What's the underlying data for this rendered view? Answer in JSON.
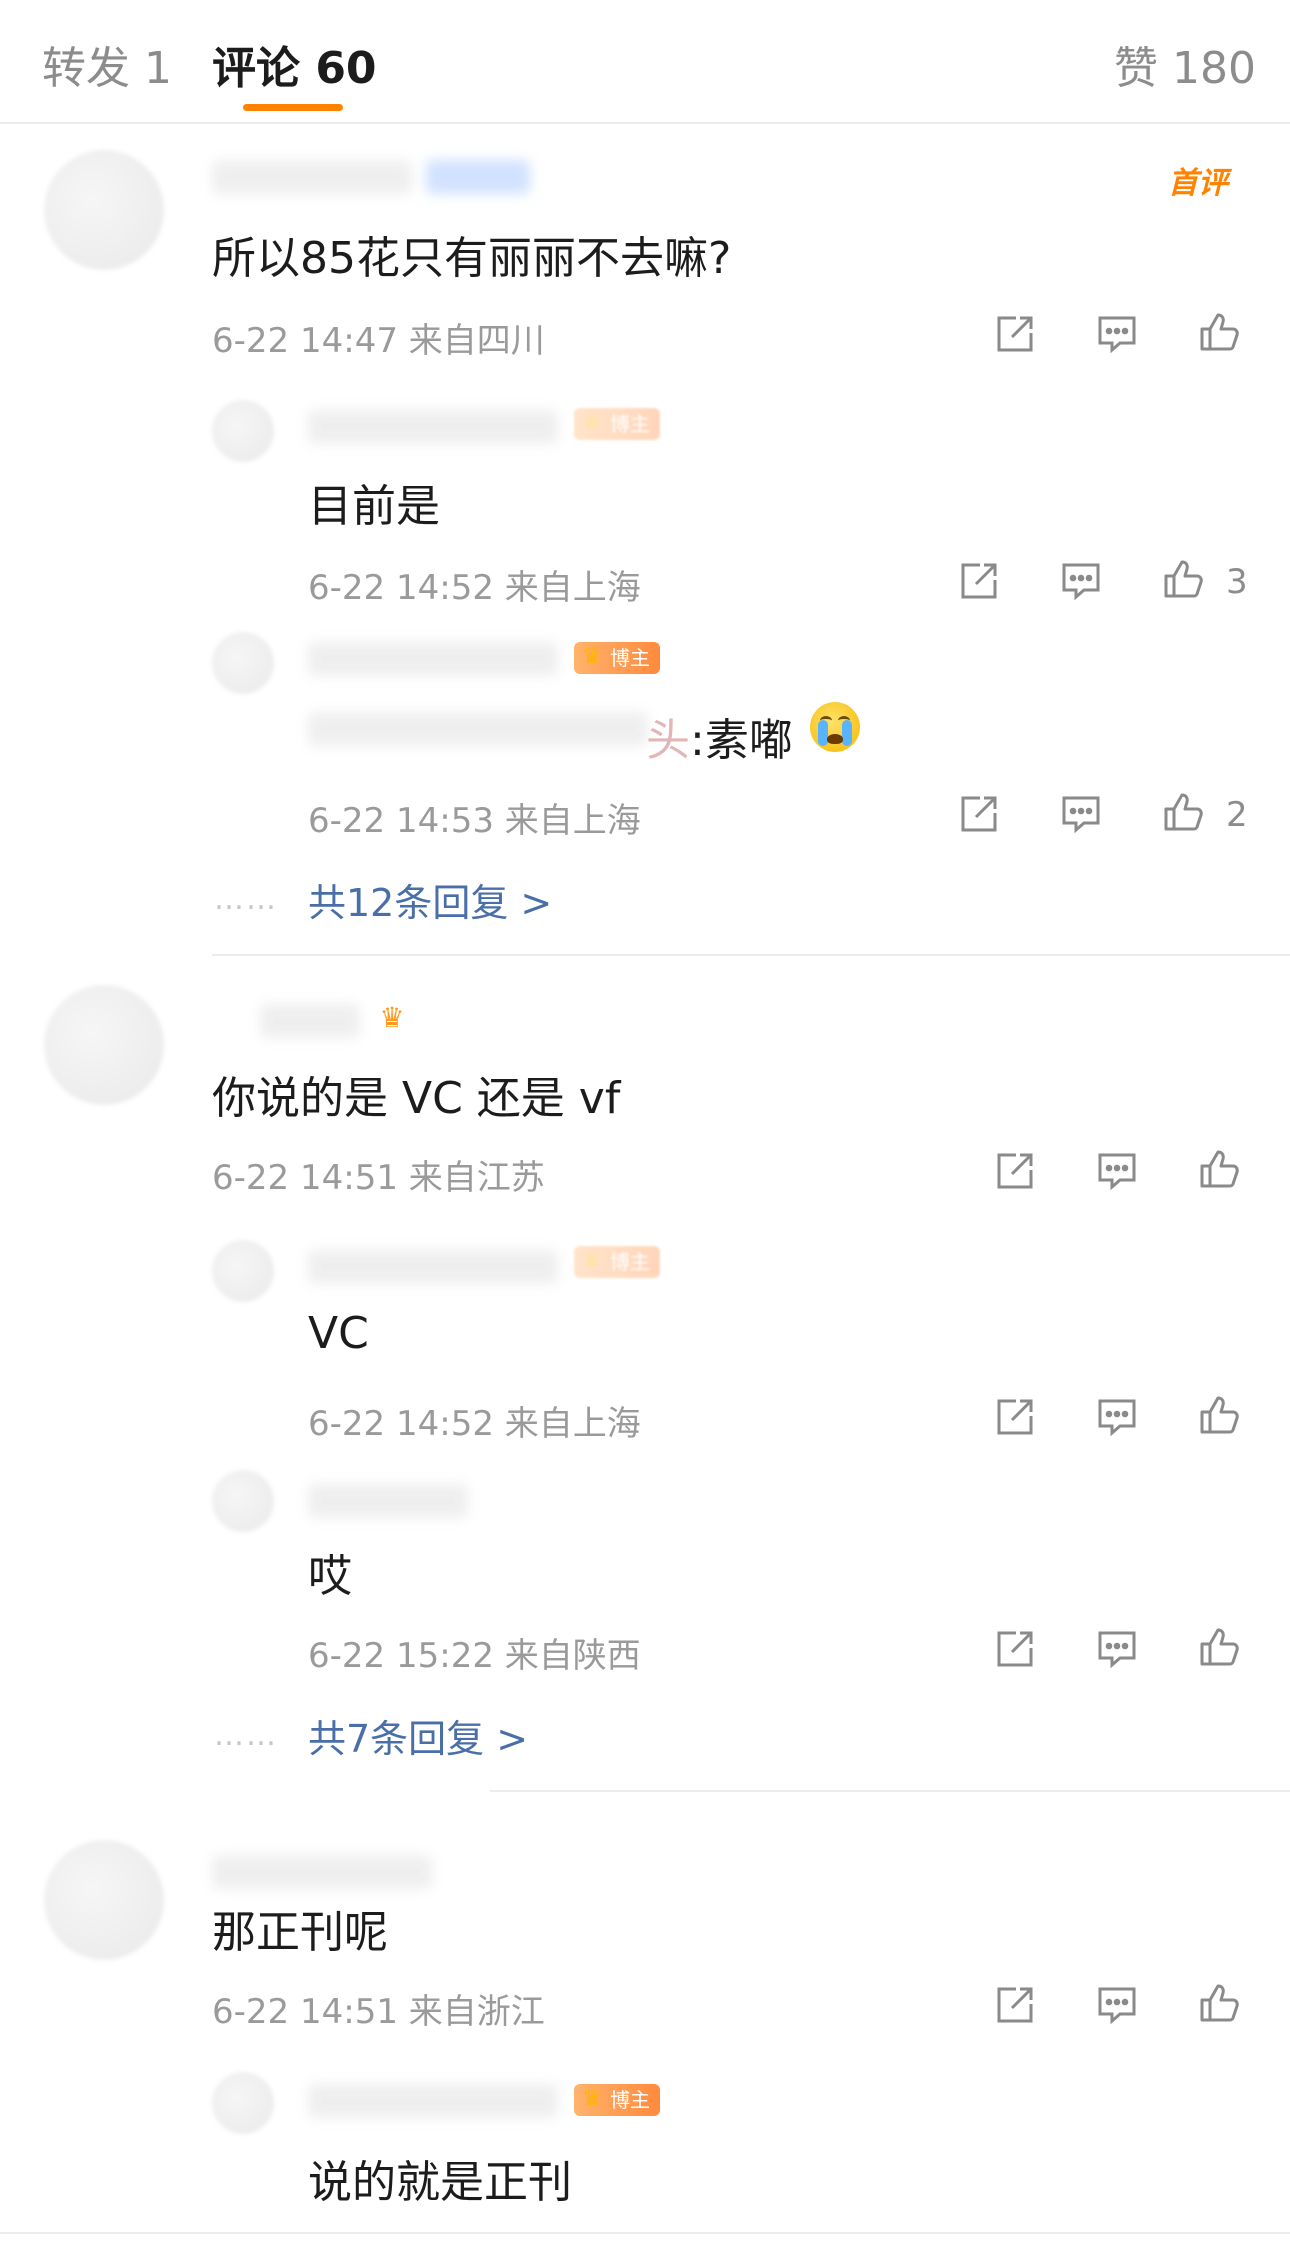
{
  "tabs": {
    "repost": "转发 1",
    "comments": "评论 60",
    "likes": "赞 180"
  },
  "icons": {
    "share": "share-icon",
    "comment": "comment-icon",
    "like": "thumbs-up-icon"
  },
  "colors": {
    "accent": "#ff8200",
    "link": "#4a6fa8",
    "meta": "#9a9a9a"
  },
  "comments": [
    {
      "first_tag": "首评",
      "text": "所以85花只有丽丽不去嘛?",
      "meta": "6-22 14:47  来自四川",
      "replies": [
        {
          "badge": "博主",
          "text": "目前是",
          "meta": "6-22 14:52  来自上海",
          "likes": "3"
        },
        {
          "badge": "博主",
          "mention": "头",
          "text": ":素嘟",
          "meta": "6-22 14:53  来自上海",
          "likes": "2"
        }
      ],
      "more": "共12条回复 >"
    },
    {
      "text": "你说的是 VC 还是 vf",
      "meta": "6-22 14:51  来自江苏",
      "replies": [
        {
          "badge": "博主",
          "text": "VC",
          "meta": "6-22 14:52  来自上海"
        },
        {
          "text": "哎",
          "meta": "6-22 15:22  来自陕西"
        }
      ],
      "more": "共7条回复 >"
    },
    {
      "text": "那正刊呢",
      "meta": "6-22 14:51  来自浙江",
      "replies": [
        {
          "badge": "博主",
          "text": "说的就是正刊"
        }
      ]
    }
  ]
}
